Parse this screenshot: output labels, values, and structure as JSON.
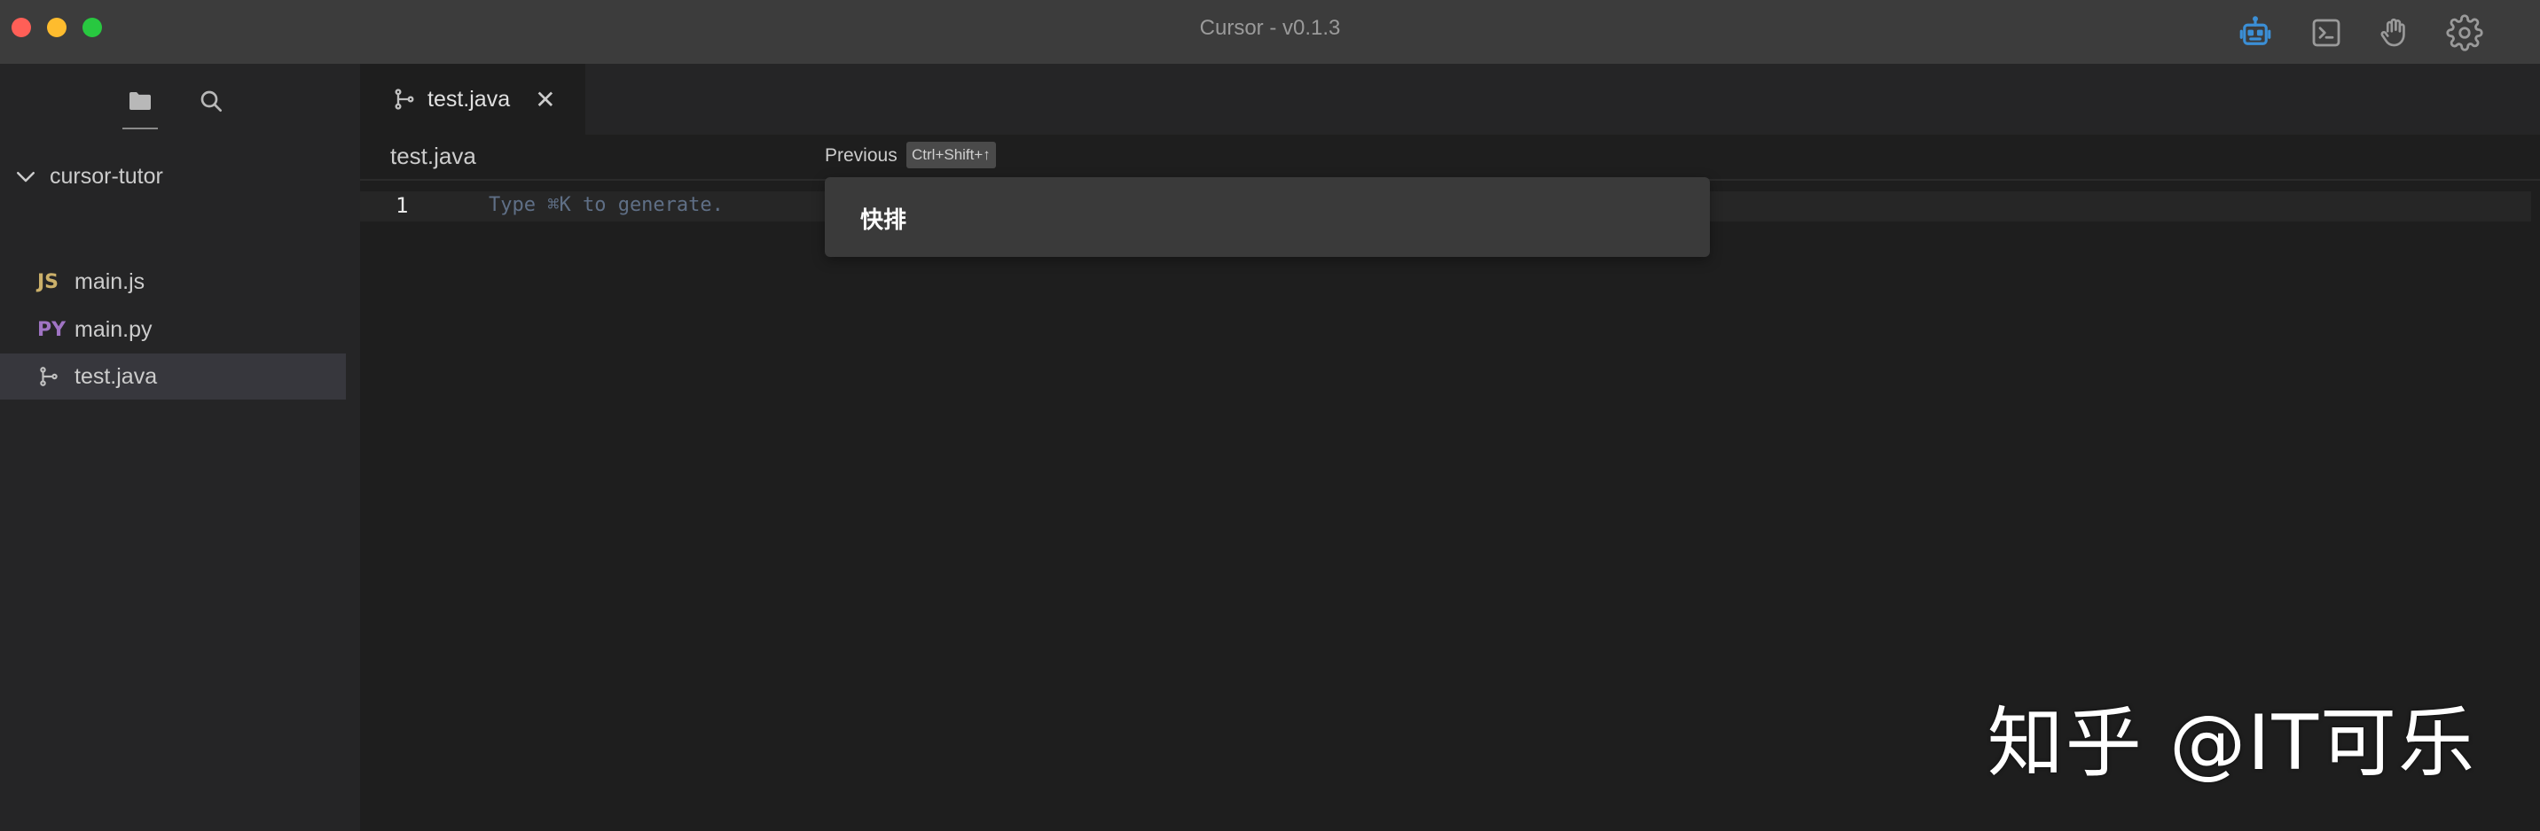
{
  "window": {
    "title": "Cursor - v0.1.3"
  },
  "titlebar_icons": [
    "robot-icon",
    "terminal-icon",
    "hand-wave-icon",
    "gear-icon"
  ],
  "sidebar": {
    "tabs": [
      "folder-icon",
      "search-icon"
    ],
    "folder": {
      "name": "cursor-tutor",
      "expanded": true
    },
    "files": [
      {
        "badge": "JS",
        "name": "main.js",
        "selected": false
      },
      {
        "badge": "PY",
        "name": "main.py",
        "selected": false
      },
      {
        "badge": "git-branch-icon",
        "name": "test.java",
        "selected": true
      }
    ]
  },
  "editor": {
    "tab": {
      "label": "test.java",
      "close": "✕"
    },
    "breadcrumb": "test.java",
    "previous_label": "Previous",
    "previous_shortcut": "Ctrl+Shift+↑",
    "line_number": "1",
    "placeholder": "Type ⌘K to generate."
  },
  "popup": {
    "text": "快排"
  },
  "watermark": "知乎 @IT可乐",
  "colors": {
    "accent_blue": "#3b8fd6",
    "titlebar": "#3c3c3c",
    "sidebar": "#252526",
    "editor": "#1e1e1e",
    "popup": "#3a3a3a"
  }
}
